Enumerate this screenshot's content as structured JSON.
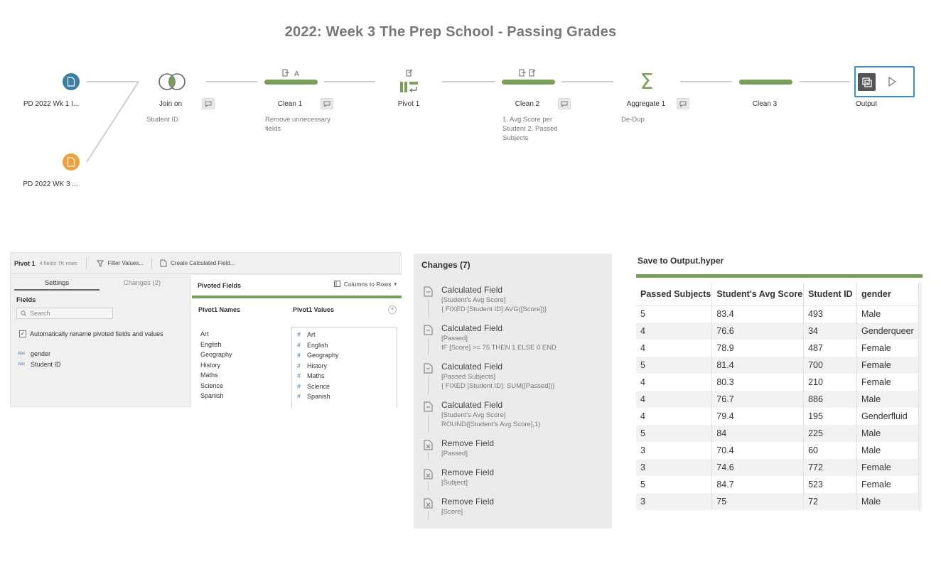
{
  "title": "2022: Week 3 The Prep School - Passing Grades",
  "colors": {
    "accent_green": "#7a9f58",
    "input_blue": "#3d7ea6",
    "input_orange": "#f0a03a",
    "selected_border": "#3c8fd6"
  },
  "flow": {
    "inputs": [
      {
        "label": "PD 2022 Wk 1 I...",
        "icon": "file-icon"
      },
      {
        "label": "PD 2022 WK 3 ...",
        "icon": "file-icon"
      }
    ],
    "steps": [
      {
        "label": "Join on",
        "sub": "Student ID",
        "icon": "join-icon"
      },
      {
        "label": "Clean 1",
        "sub": "Remove unnecessary fields",
        "icon": "clean-icon"
      },
      {
        "label": "Pivot 1",
        "sub": "",
        "icon": "pivot-icon"
      },
      {
        "label": "Clean 2",
        "sub": "1. Avg Score per Student 2. Passed Subjects",
        "icon": "clean-icon"
      },
      {
        "label": "Aggregate 1",
        "sub": "De-Dup",
        "icon": "sigma-icon"
      },
      {
        "label": "Clean 3",
        "sub": "",
        "icon": "clean-icon"
      },
      {
        "label": "Output",
        "sub": "",
        "icon": "output-icon"
      }
    ]
  },
  "pivot_panel": {
    "name": "Pivot 1",
    "meta": "4 fields  7K rows",
    "filter_label": "Filter Values...",
    "calc_label": "Create Calculated Field...",
    "tab_settings": "Settings",
    "tab_changes": "Changes (2)",
    "fields_heading": "Fields",
    "search_placeholder": "Search",
    "auto_rename_label": "Automatically rename pivoted fields and values",
    "auto_rename_checked": true,
    "fields": [
      {
        "type": "Abc",
        "name": "gender"
      },
      {
        "type": "Abc",
        "name": "Student ID"
      }
    ],
    "pivoted_fields_heading": "Pivoted Fields",
    "columns_to_rows": "Columns to Rows",
    "names_heading": "Pivot1 Names",
    "values_heading": "Pivot1 Values",
    "names": [
      "Art",
      "English",
      "Geography",
      "History",
      "Maths",
      "Science",
      "Spanish"
    ],
    "values": [
      "Art",
      "English",
      "Geography",
      "History",
      "Maths",
      "Science",
      "Spanish"
    ]
  },
  "changes": {
    "title": "Changes (7)",
    "items": [
      {
        "type": "Calculated Field",
        "details": [
          "[Student's Avg Score]",
          "{ FIXED [Student ID]:AVG([Score])}"
        ]
      },
      {
        "type": "Calculated Field",
        "details": [
          "[Passed]",
          "IF [Score] >= 75 THEN 1 ELSE 0 END"
        ]
      },
      {
        "type": "Calculated Field",
        "details": [
          "[Passed Subjects]",
          "{ FIXED [Student ID]: SUM([Passed])}"
        ]
      },
      {
        "type": "Calculated Field",
        "details": [
          "[Student's Avg Score]",
          "ROUND([Student's Avg Score],1)"
        ]
      },
      {
        "type": "Remove Field",
        "details": [
          "[Passed]"
        ]
      },
      {
        "type": "Remove Field",
        "details": [
          "[Subject]"
        ]
      },
      {
        "type": "Remove Field",
        "details": [
          "[Score]"
        ]
      }
    ]
  },
  "output": {
    "title": "Save to Output.hyper",
    "columns": [
      "Passed Subjects",
      "Student's Avg Score",
      "Student ID",
      "gender"
    ],
    "rows": [
      [
        "5",
        "83.4",
        "493",
        "Male"
      ],
      [
        "4",
        "76.6",
        "34",
        "Genderqueer"
      ],
      [
        "4",
        "78.9",
        "487",
        "Female"
      ],
      [
        "5",
        "81.4",
        "700",
        "Female"
      ],
      [
        "4",
        "80.3",
        "210",
        "Female"
      ],
      [
        "4",
        "76.7",
        "886",
        "Male"
      ],
      [
        "4",
        "79.4",
        "195",
        "Genderfluid"
      ],
      [
        "5",
        "84",
        "225",
        "Male"
      ],
      [
        "3",
        "70.4",
        "60",
        "Male"
      ],
      [
        "3",
        "74.6",
        "772",
        "Female"
      ],
      [
        "5",
        "84.7",
        "523",
        "Female"
      ],
      [
        "3",
        "75",
        "72",
        "Male"
      ]
    ]
  }
}
